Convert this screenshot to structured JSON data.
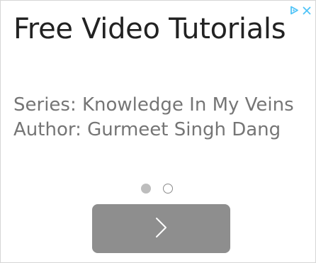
{
  "ad": {
    "headline": "Free Video Tutorials",
    "description": "Series: Knowledge In My Veins Author: Gurmeet Singh Dang"
  },
  "controls": {
    "adchoices_icon": "adchoices-play-icon",
    "close_icon": "close-icon",
    "icon_color": "#4fc3f7"
  },
  "pager": {
    "total": 2,
    "active_index": 0
  },
  "next_button": {
    "icon": "chevron-right-icon",
    "background": "#8e8e8e",
    "icon_color": "#ffffff"
  }
}
